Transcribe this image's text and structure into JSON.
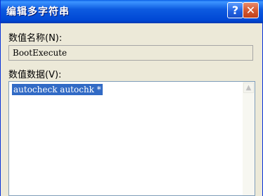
{
  "window": {
    "title": "编辑多字符串",
    "help_glyph": "?",
    "close_glyph": "✕"
  },
  "fields": {
    "name_label": "数值名称(N):",
    "name_value": "BootExecute",
    "data_label": "数值数据(V):",
    "data_value": "autocheck autochk *"
  },
  "scrollbar": {
    "up_arrow_glyph": "▲"
  },
  "colors": {
    "title_bar": "#0054e3",
    "selection": "#316ac5",
    "dialog_bg": "#ece9d8",
    "close_button": "#d45a32"
  }
}
